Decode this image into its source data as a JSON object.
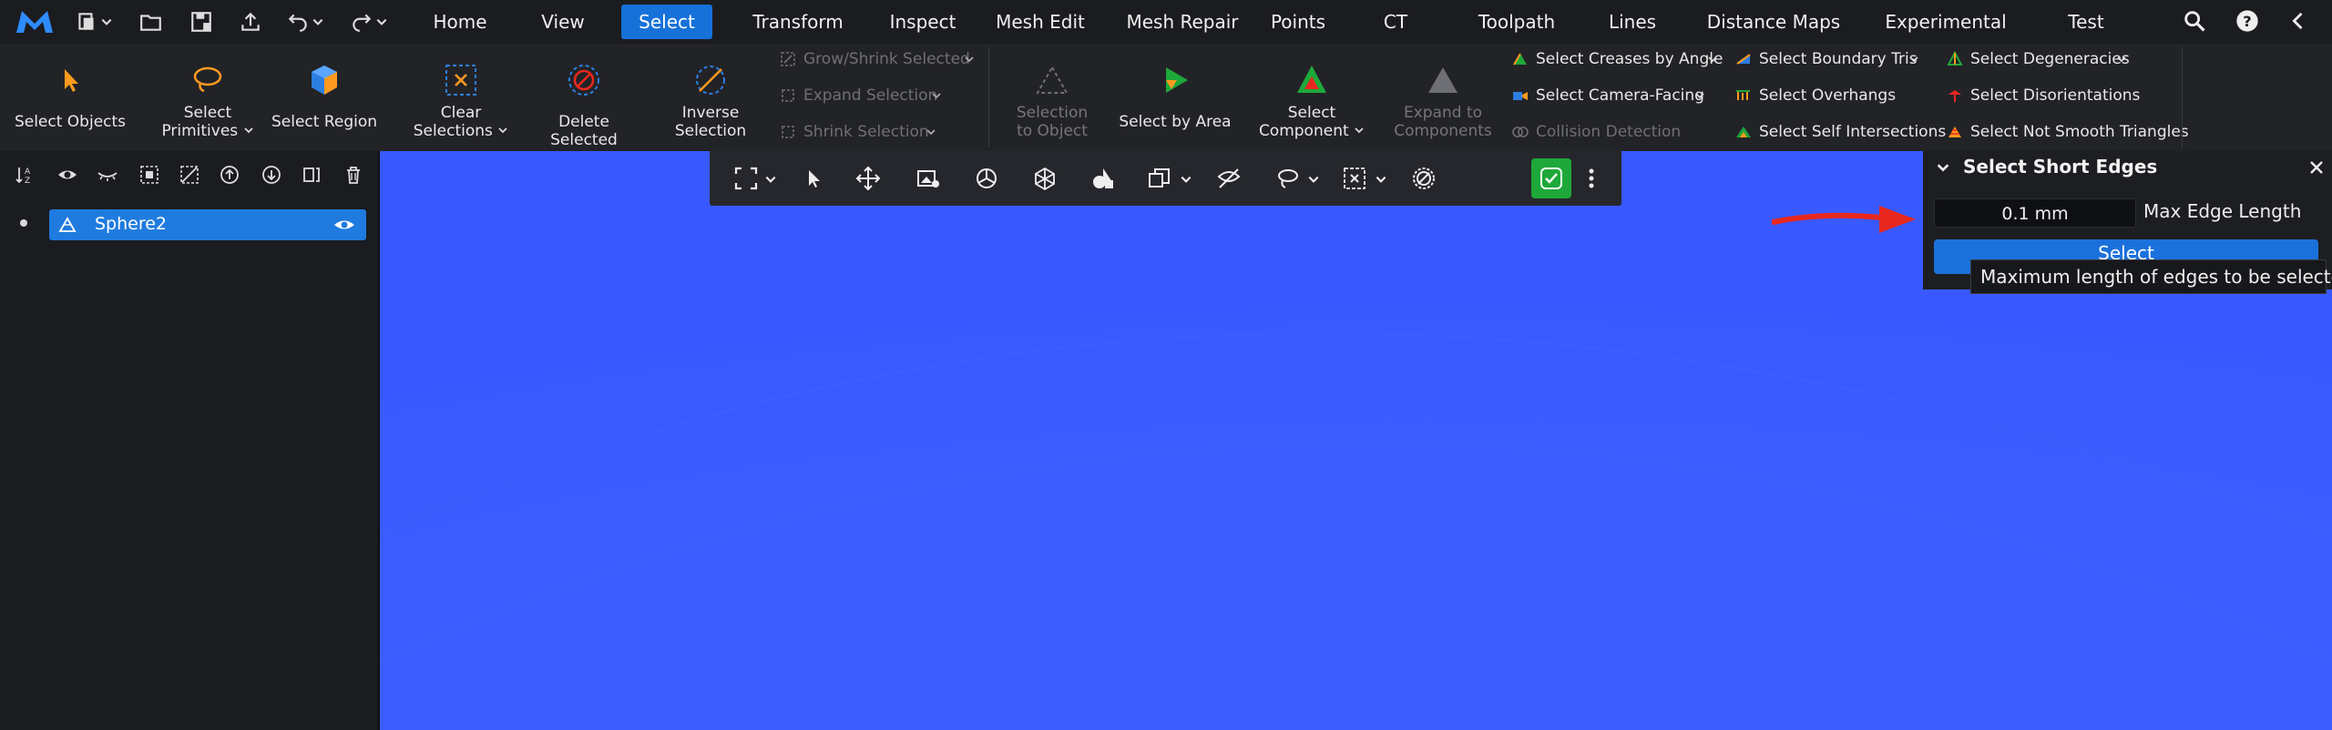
{
  "menubar": {
    "tabs": [
      "Home",
      "View",
      "Select",
      "Transform",
      "Inspect",
      "Mesh Edit",
      "Mesh Repair",
      "Points",
      "CT",
      "Toolpath",
      "Lines",
      "Distance Maps",
      "Experimental",
      "Test"
    ],
    "active_tab": "Select"
  },
  "ribbon": {
    "select_objects": "Select Objects",
    "select_primitives_1": "Select",
    "select_primitives_2": "Primitives",
    "select_region": "Select Region",
    "clear_selections_1": "Clear",
    "clear_selections_2": "Selections",
    "delete_selected": "Delete Selected",
    "inverse_selection_1": "Inverse",
    "inverse_selection_2": "Selection",
    "grow_shrink": "Grow/Shrink Selected",
    "expand_selection": "Expand Selection",
    "shrink_selection": "Shrink Selection",
    "selection_to_object_1": "Selection",
    "selection_to_object_2": "to Object",
    "select_by_area": "Select by Area",
    "select_component_1": "Select",
    "select_component_2": "Component",
    "expand_to_components_1": "Expand to",
    "expand_to_components_2": "Components",
    "select_creases": "Select Creases by Angle",
    "select_camera_facing": "Select Camera-Facing",
    "collision_detection": "Collision Detection",
    "select_boundary_tris": "Select Boundary Tris",
    "select_overhangs": "Select Overhangs",
    "select_self_intersections": "Select Self Intersections",
    "select_degeneracies": "Select Degeneracies",
    "select_disorientations": "Select Disorientations",
    "select_not_smooth": "Select Not Smooth Triangles"
  },
  "scene_tree": {
    "items": [
      {
        "label": "Sphere2"
      }
    ]
  },
  "select_short_edges": {
    "title": "Select Short Edges",
    "max_edge_value": "0.1 mm",
    "max_edge_label": "Max Edge Length",
    "select_button": "Select",
    "tooltip": "Maximum length of edges to be selected."
  },
  "colors": {
    "accent": "#1671d9",
    "viewport": "#3859ff",
    "arrow": "#e8281e",
    "check_green": "#1fa83a"
  }
}
